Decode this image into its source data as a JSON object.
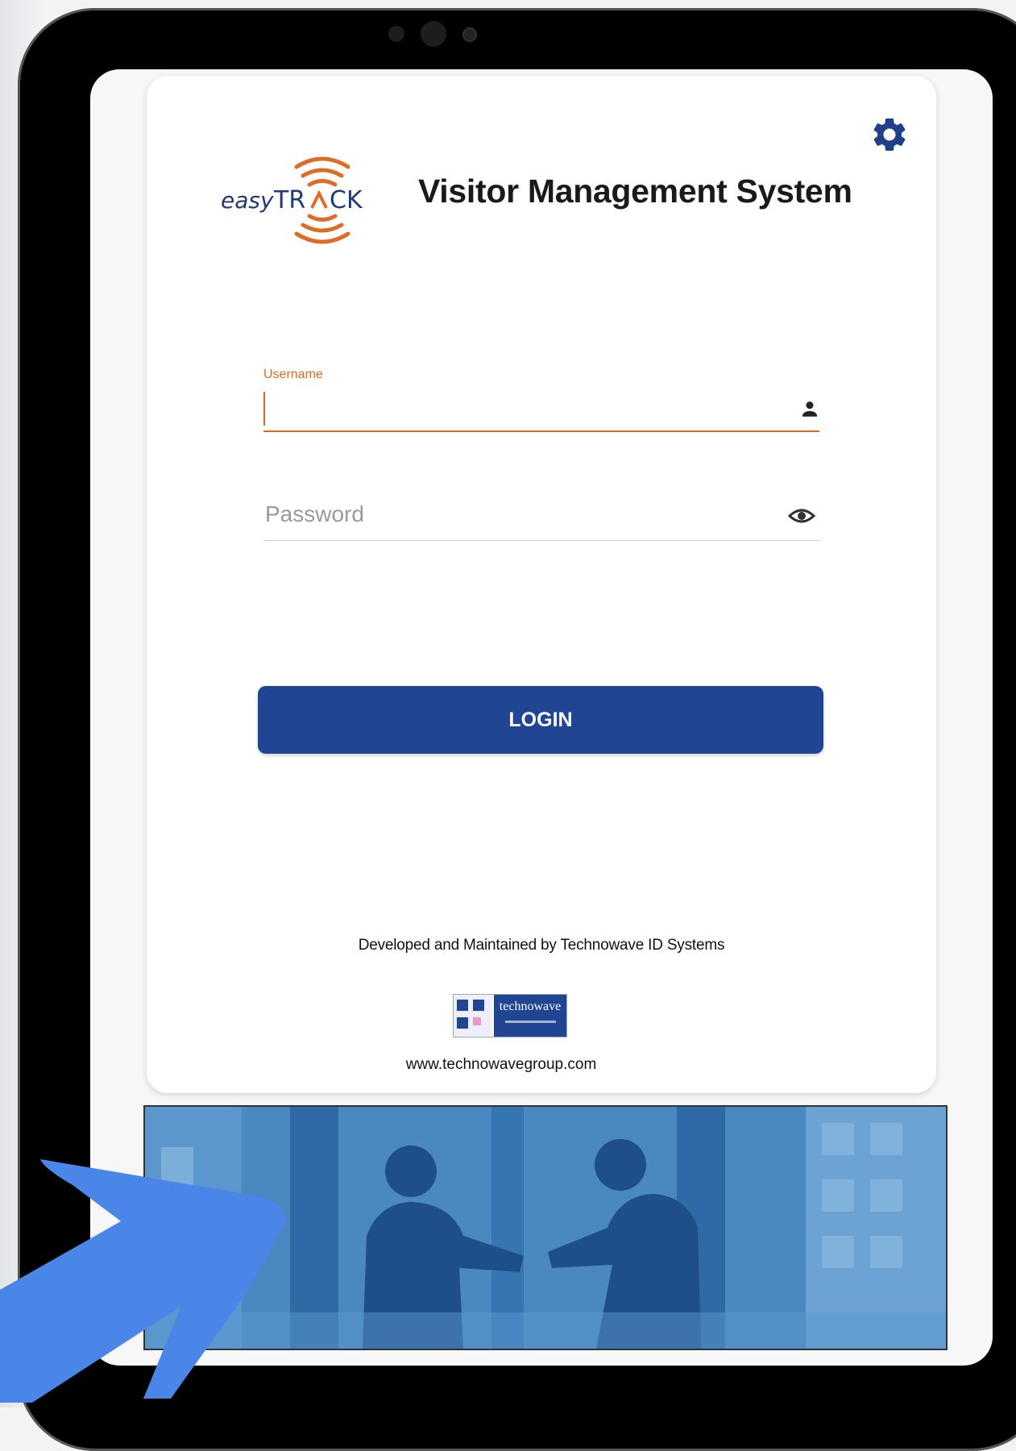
{
  "app": {
    "brand": "easyTRACK",
    "title": "Visitor Management System"
  },
  "login": {
    "username_label": "Username",
    "username_value": "",
    "password_placeholder": "Password",
    "login_label": "LOGIN"
  },
  "footer": {
    "developed_by": "Developed and Maintained by Technowave ID Systems",
    "partner_logo": "technowave",
    "website": "www.technowavegroup.com"
  },
  "icons": {
    "settings": "gear-icon",
    "username": "person-icon",
    "password_toggle": "eye-icon"
  },
  "colors": {
    "accent": "#d9691f",
    "primary_button": "#1f4593",
    "gear": "#1f3f8a",
    "banner": "#3a7bb6",
    "annotation_arrow": "#4a86e8"
  }
}
